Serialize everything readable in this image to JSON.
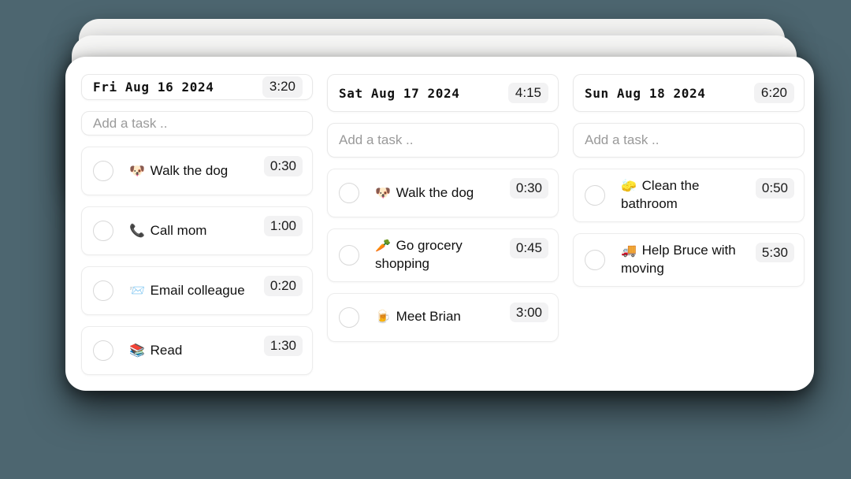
{
  "theme": {
    "background": "#4d6670",
    "card_background": "#ffffff",
    "badge_background": "#f2f2f3",
    "text_color": "#111111",
    "placeholder_color": "#9a9a9a",
    "border_color": "#e8e8e8"
  },
  "columns": [
    {
      "id": "day-1",
      "date": "Fri Aug 16 2024",
      "total_time": "3:20",
      "add_task_placeholder": "Add a task ..",
      "add_task_value": "",
      "tasks": [
        {
          "emoji": "🐶",
          "emoji_name": "dog-face-emoji",
          "label": "Walk the dog",
          "duration": "0:30",
          "done": false
        },
        {
          "emoji": "📞",
          "emoji_name": "telephone-receiver-emoji",
          "label": "Call mom",
          "duration": "1:00",
          "done": false
        },
        {
          "emoji": "📨",
          "emoji_name": "incoming-envelope-emoji",
          "label": "Email colleague",
          "duration": "0:20",
          "done": false
        },
        {
          "emoji": "📚",
          "emoji_name": "books-emoji",
          "label": "Read",
          "duration": "1:30",
          "done": false
        }
      ]
    },
    {
      "id": "day-2",
      "date": "Sat Aug 17 2024",
      "total_time": "4:15",
      "add_task_placeholder": "Add a task ..",
      "add_task_value": "",
      "tasks": [
        {
          "emoji": "🐶",
          "emoji_name": "dog-face-emoji",
          "label": "Walk the dog",
          "duration": "0:30",
          "done": false
        },
        {
          "emoji": "🥕",
          "emoji_name": "carrot-emoji",
          "label": "Go grocery shopping",
          "duration": "0:45",
          "done": false
        },
        {
          "emoji": "🍺",
          "emoji_name": "beer-mug-emoji",
          "label": "Meet Brian",
          "duration": "3:00",
          "done": false
        }
      ]
    },
    {
      "id": "day-3",
      "date": "Sun Aug 18 2024",
      "total_time": "6:20",
      "add_task_placeholder": "Add a task ..",
      "add_task_value": "",
      "tasks": [
        {
          "emoji": "🧽",
          "emoji_name": "sponge-emoji",
          "label": "Clean the bathroom",
          "duration": "0:50",
          "done": false
        },
        {
          "emoji": "🚚",
          "emoji_name": "delivery-truck-emoji",
          "label": "Help Bruce with moving",
          "duration": "5:30",
          "done": false
        }
      ]
    }
  ]
}
